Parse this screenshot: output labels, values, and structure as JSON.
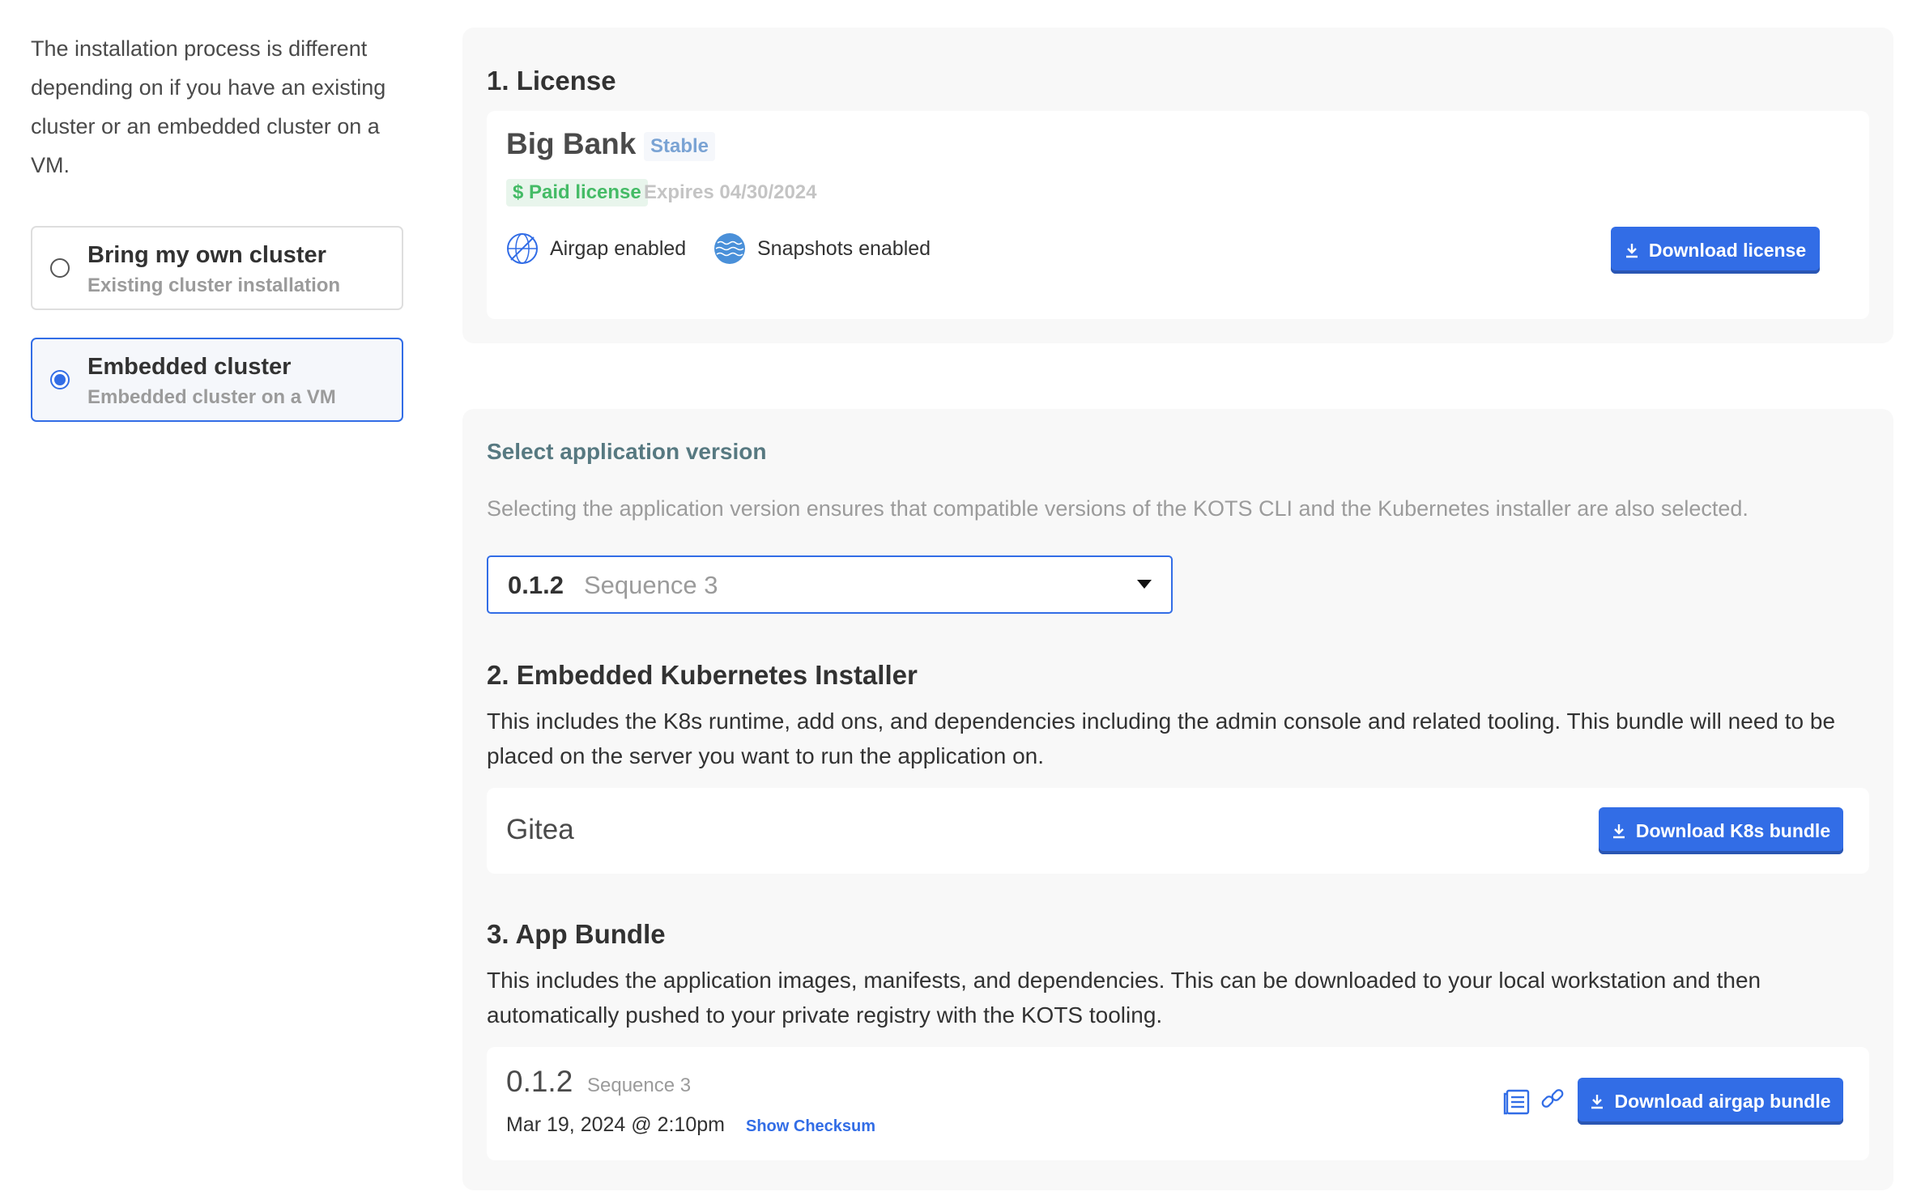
{
  "sidebar": {
    "intro": "The installation process is different depending on if you have an existing cluster or an embedded cluster on a VM.",
    "options": [
      {
        "title": "Bring my own cluster",
        "subtitle": "Existing cluster installation",
        "selected": false
      },
      {
        "title": "Embedded cluster",
        "subtitle": "Embedded cluster on a VM",
        "selected": true
      }
    ]
  },
  "license": {
    "heading": "1. License",
    "customer": "Big Bank",
    "channel": "Stable",
    "license_type": "$ Paid license",
    "expires": "Expires 04/30/2024",
    "features": [
      {
        "icon": "airgap-icon",
        "label": "Airgap enabled"
      },
      {
        "icon": "snapshots-icon",
        "label": "Snapshots enabled"
      }
    ],
    "download_label": "Download license"
  },
  "version": {
    "label": "Select application version",
    "help": "Selecting the application version ensures that compatible versions of the KOTS CLI and the Kubernetes installer are also selected.",
    "selected_version": "0.1.2",
    "selected_sequence": "Sequence 3"
  },
  "installer": {
    "heading": "2. Embedded Kubernetes Installer",
    "description": "This includes the K8s runtime, add ons, and dependencies including the admin console and related tooling. This bundle will need to be placed on the server you want to run the application on.",
    "name": "Gitea",
    "download_label": "Download K8s bundle"
  },
  "app_bundle": {
    "heading": "3. App Bundle",
    "description": "This includes the application images, manifests, and dependencies. This can be downloaded to your local workstation and then automatically pushed to your private registry with the KOTS tooling.",
    "version": "0.1.2",
    "sequence": "Sequence 3",
    "date": "Mar 19, 2024 @ 2:10pm",
    "checksum_label": "Show Checksum",
    "download_label": "Download airgap bundle"
  },
  "colors": {
    "accent": "#326de6",
    "paid": "#44bb66",
    "channel": "#7aa3d4"
  }
}
